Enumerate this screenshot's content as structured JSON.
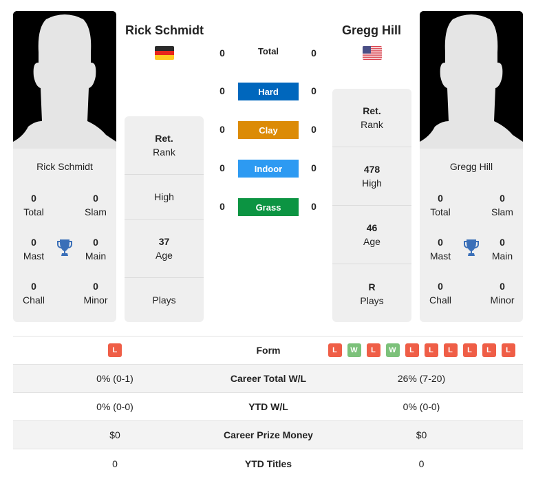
{
  "player1": {
    "name": "Rick Schmidt",
    "flag": "germany-flag",
    "card_name": "Rick Schmidt",
    "titles": {
      "total": {
        "value": "0",
        "label": "Total"
      },
      "slam": {
        "value": "0",
        "label": "Slam"
      },
      "mast": {
        "value": "0",
        "label": "Mast"
      },
      "main": {
        "value": "0",
        "label": "Main"
      },
      "chall": {
        "value": "0",
        "label": "Chall"
      },
      "minor": {
        "value": "0",
        "label": "Minor"
      }
    },
    "info": {
      "rank": {
        "value": "Ret.",
        "label": "Rank"
      },
      "high": {
        "value": "",
        "label": "High"
      },
      "age": {
        "value": "37",
        "label": "Age"
      },
      "plays": {
        "value": "",
        "label": "Plays"
      }
    }
  },
  "player2": {
    "name": "Gregg Hill",
    "flag": "usa-flag",
    "card_name": "Gregg Hill",
    "titles": {
      "total": {
        "value": "0",
        "label": "Total"
      },
      "slam": {
        "value": "0",
        "label": "Slam"
      },
      "mast": {
        "value": "0",
        "label": "Mast"
      },
      "main": {
        "value": "0",
        "label": "Main"
      },
      "chall": {
        "value": "0",
        "label": "Chall"
      },
      "minor": {
        "value": "0",
        "label": "Minor"
      }
    },
    "info": {
      "rank": {
        "value": "Ret.",
        "label": "Rank"
      },
      "high": {
        "value": "478",
        "label": "High"
      },
      "age": {
        "value": "46",
        "label": "Age"
      },
      "plays": {
        "value": "R",
        "label": "Plays"
      }
    }
  },
  "h2h": {
    "total": {
      "label": "Total",
      "p1": "0",
      "p2": "0"
    },
    "surfaces": [
      {
        "label": "Hard",
        "p1": "0",
        "p2": "0",
        "color": "#0067bd"
      },
      {
        "label": "Clay",
        "p1": "0",
        "p2": "0",
        "color": "#dc8b06"
      },
      {
        "label": "Indoor",
        "p1": "0",
        "p2": "0",
        "color": "#2d9af2"
      },
      {
        "label": "Grass",
        "p1": "0",
        "p2": "0",
        "color": "#0c9442"
      }
    ]
  },
  "comparison": {
    "form": {
      "label": "Form",
      "p1": [
        "L"
      ],
      "p2": [
        "L",
        "W",
        "L",
        "W",
        "L",
        "L",
        "L",
        "L",
        "L",
        "L"
      ]
    },
    "rows": [
      {
        "label": "Career Total W/L",
        "p1": "0% (0-1)",
        "p2": "26% (7-20)"
      },
      {
        "label": "YTD W/L",
        "p1": "0% (0-0)",
        "p2": "0% (0-0)"
      },
      {
        "label": "Career Prize Money",
        "p1": "$0",
        "p2": "$0"
      },
      {
        "label": "YTD Titles",
        "p1": "0",
        "p2": "0"
      }
    ]
  }
}
